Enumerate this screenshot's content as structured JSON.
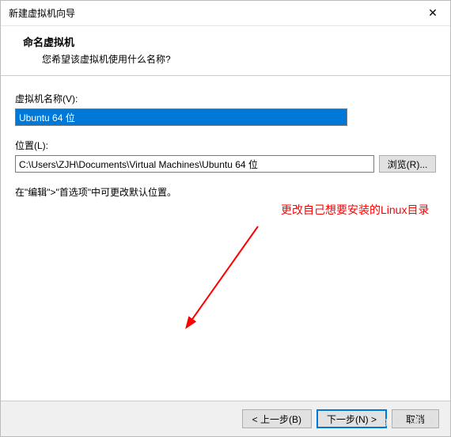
{
  "window": {
    "title": "新建虚拟机向导",
    "close_glyph": "✕"
  },
  "header": {
    "title": "命名虚拟机",
    "description": "您希望该虚拟机使用什么名称?"
  },
  "fields": {
    "name_label": "虚拟机名称(V):",
    "name_value": "Ubuntu 64 位",
    "location_label": "位置(L):",
    "location_value": "C:\\Users\\ZJH\\Documents\\Virtual Machines\\Ubuntu 64 位",
    "browse_label": "浏览(R)...",
    "hint": "在\"编辑\">\"首选项\"中可更改默认位置。"
  },
  "annotation": {
    "text": "更改自己想要安装的Linux目录"
  },
  "footer": {
    "back": "< 上一步(B)",
    "next": "下一步(N) >",
    "cancel": "取消"
  },
  "watermark": "g_45 9817"
}
